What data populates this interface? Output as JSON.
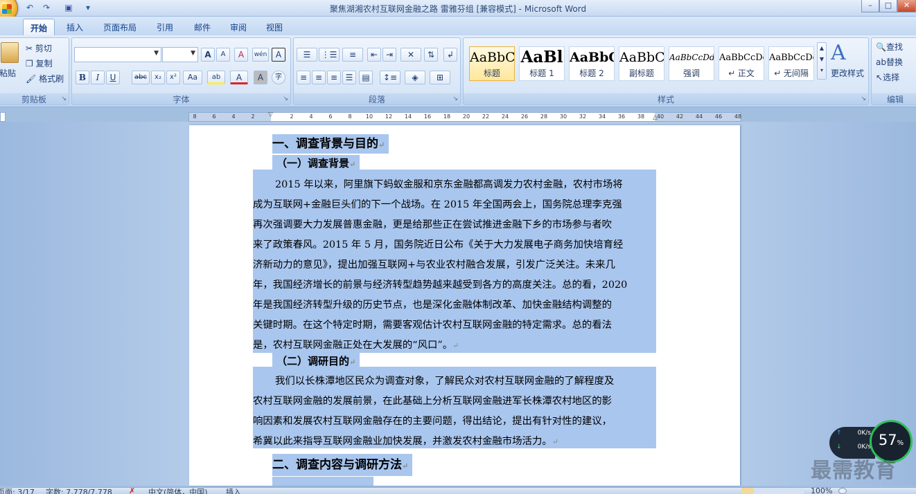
{
  "window": {
    "title": "聚焦湖湘农村互联网金融之路  雷雅芬组 [兼容模式] - Microsoft Word",
    "controls": {
      "minimize": "–",
      "maximize": "□",
      "close": "✕"
    }
  },
  "quick_access": {
    "undo": "↶",
    "redo": "↷",
    "save": "💾",
    "customize": "▾"
  },
  "ribbon": {
    "tabs": [
      "开始",
      "插入",
      "页面布局",
      "引用",
      "邮件",
      "审阅",
      "视图"
    ],
    "active_tab": "开始",
    "clipboard": {
      "paste": "粘贴",
      "cut": "剪切",
      "copy": "复制",
      "format_painter": "格式刷",
      "label": "剪贴板"
    },
    "font": {
      "family_value": "",
      "size_value": "",
      "label": "字体",
      "grow": "A",
      "shrink": "A",
      "clear": "A",
      "phonetic": "wén",
      "border_char": "A",
      "bold": "B",
      "italic": "I",
      "underline": "U",
      "strike": "abc",
      "subscript": "x₂",
      "superscript": "x²",
      "case": "Aa",
      "highlight": "ab",
      "color": "A",
      "shade": "A",
      "enclose": "字"
    },
    "paragraph": {
      "label": "段落"
    },
    "styles": {
      "label": "样式",
      "items": [
        {
          "sample": "AaBbC",
          "name": "标题"
        },
        {
          "sample": "AaBl",
          "name": "标题 1"
        },
        {
          "sample": "AaBbC",
          "name": "标题 2"
        },
        {
          "sample": "AaBbC",
          "name": "副标题"
        },
        {
          "sample": "AaBbCcDd",
          "name": "强调"
        },
        {
          "sample": "AaBbCcDc",
          "name": "↵ 正文"
        },
        {
          "sample": "AaBbCcDc",
          "name": "↵ 无间隔"
        }
      ],
      "change_styles": "更改样式"
    },
    "editing": {
      "label": "编辑",
      "find": "查找",
      "replace": "替换",
      "select": "选择"
    }
  },
  "ruler": {
    "numbers": [
      "8",
      "6",
      "4",
      "2",
      "",
      "2",
      "4",
      "6",
      "8",
      "10",
      "12",
      "14",
      "16",
      "18",
      "20",
      "22",
      "24",
      "26",
      "28",
      "30",
      "32",
      "34",
      "36",
      "38",
      "40",
      "42",
      "44",
      "46",
      "48"
    ]
  },
  "document": {
    "h1_a": "一、调查背景与目的",
    "h2_a": "（一）调查背景",
    "p1": [
      "2015 年以来，阿里旗下蚂蚁金服和京东金融都高调发力农村金融，农村市场将",
      "成为互联网+金融巨头们的下一个战场。在 2015 年全国两会上，国务院总理李克强",
      "再次强调要大力发展普惠金融，更是给那些正在尝试推进金融下乡的市场参与者吹",
      "来了政策春风。2015 年 5 月，国务院近日公布《关于大力发展电子商务加快培育经",
      "济新动力的意见》，提出加强互联网+与农业农村融合发展，引发广泛关注。未来几",
      "年，我国经济增长的前景与经济转型趋势越来越受到各方的高度关注。总的看，2020",
      "年是我国经济转型升级的历史节点，也是深化金融体制改革、加快金融结构调整的",
      "关键时期。在这个特定时期，需要客观估计农村互联网金融的特定需求。总的看法",
      "是，农村互联网金融正处在大发展的“风口”。"
    ],
    "h2_b": "（二）调研目的",
    "p2": [
      "我们以长株潭地区民众为调查对象，了解民众对农村互联网金融的了解程度及",
      "农村互联网金融的发展前景，在此基础上分析互联网金融进军长株潭农村地区的影",
      "响因素和发展农村互联网金融存在的主要问题，得出结论，提出有针对性的建议，",
      "希冀以此来指导互联网金融业加快发展，并激发农村金融市场活力。"
    ],
    "h1_b": "二、调查内容与调研方法",
    "paragraph_mark": "↵"
  },
  "status_bar": {
    "page": "页面: 3/17",
    "words": "字数: 7,778/7,778",
    "language": "中文(简体，中国)",
    "insert": "插入",
    "zoom": "100%"
  },
  "net_widget": {
    "up": "0K/s",
    "down": "0K/s",
    "percent": "57",
    "pct_sign": "%"
  },
  "watermark": "最需教育"
}
